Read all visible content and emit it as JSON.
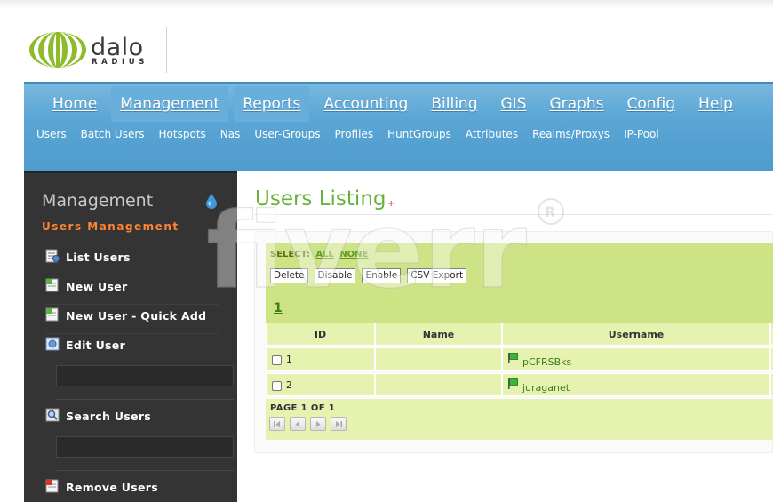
{
  "logo": {
    "name": "dalo",
    "subname": "RADIUS"
  },
  "nav": {
    "main_tabs": [
      {
        "label": "Home",
        "active": false
      },
      {
        "label": "Management",
        "active": true
      },
      {
        "label": "Reports",
        "active": true
      },
      {
        "label": "Accounting",
        "active": false
      },
      {
        "label": "Billing",
        "active": false
      },
      {
        "label": "GIS",
        "active": false
      },
      {
        "label": "Graphs",
        "active": false
      },
      {
        "label": "Config",
        "active": false
      },
      {
        "label": "Help",
        "active": false
      }
    ],
    "sub_tabs": [
      "Users",
      "Batch Users",
      "Hotspots",
      "Nas",
      "User-Groups",
      "Profiles",
      "HuntGroups",
      "Attributes",
      "Realms/Proxys",
      "IP-Pool"
    ]
  },
  "sidebar": {
    "title": "Management",
    "section": "Users Management",
    "items": [
      {
        "label": "List Users",
        "icon": "list-users-icon"
      },
      {
        "label": "New User",
        "icon": "new-user-icon"
      },
      {
        "label": "New User - Quick Add",
        "icon": "quick-add-icon"
      },
      {
        "label": "Edit User",
        "icon": "edit-user-icon"
      },
      {
        "label": "Search Users",
        "icon": "search-users-icon"
      },
      {
        "label": "Remove Users",
        "icon": "remove-users-icon"
      }
    ],
    "edit_user_value": "",
    "search_users_value": ""
  },
  "main": {
    "title": "Users Listing",
    "title_marker": "+",
    "select": {
      "label": "SELECT:",
      "all": "ALL",
      "none": "NONE"
    },
    "buttons": [
      "Delete",
      "Disable",
      "Enable",
      "CSV Export"
    ],
    "page_link": "1",
    "table": {
      "headers": [
        "ID",
        "Name",
        "Username"
      ],
      "rows": [
        {
          "id": "1",
          "name": "",
          "username": "pCFRSBks"
        },
        {
          "id": "2",
          "name": "",
          "username": "juraganet"
        }
      ]
    },
    "pager": {
      "text": "PAGE 1 OF 1"
    }
  },
  "watermark": "fiverr",
  "colors": {
    "nav_blue": "#5aa6d5",
    "sidebar_dark": "#343434",
    "accent_orange": "#ff8533",
    "title_green": "#66b53a",
    "panel_green": "#cde385",
    "row_green": "#e5f2b0"
  }
}
